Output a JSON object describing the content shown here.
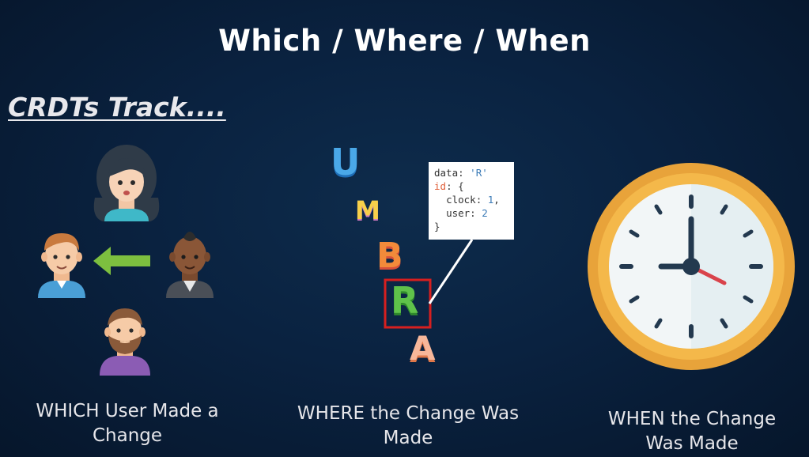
{
  "title": "Which / Where / When",
  "subtitle": "CRDTs Track....",
  "captions": {
    "which": "WHICH User Made a Change",
    "where": "WHERE the Change Was Made",
    "when": "WHEN the Change Was Made"
  },
  "letters": [
    "U",
    "M",
    "B",
    "R",
    "A"
  ],
  "code": {
    "data_key": "data",
    "data_value": "'R'",
    "id_key": "id",
    "open_brace": "{",
    "clock_key": "clock",
    "clock_value": "1",
    "user_key": "user",
    "user_value": "2",
    "close_brace": "}"
  },
  "colors": {
    "background": "#0a2240",
    "clock_rim": "#e8a33a",
    "clock_face": "#f2f6f7",
    "second_hand": "#d9434b",
    "highlight_box": "#d61f1f",
    "arrow": "#7dbf3f"
  }
}
